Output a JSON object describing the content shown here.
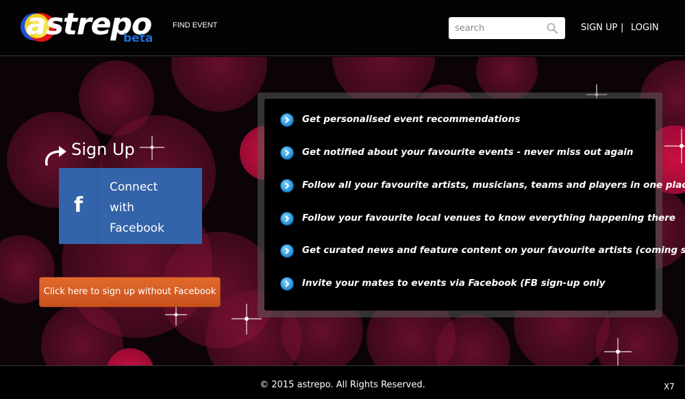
{
  "header": {
    "logo_text": "astrepo",
    "logo_badge": "beta",
    "find_event_label": "FIND EVENT",
    "search": {
      "placeholder": "search",
      "value": ""
    },
    "nav": {
      "signup_label": "SIGN UP",
      "separator": "|",
      "login_label": "LOGIN"
    }
  },
  "signup": {
    "heading": "Sign Up",
    "facebook_button": {
      "icon": "facebook-icon",
      "line1": "Connect",
      "line2": "with",
      "line3": "Facebook"
    },
    "no_facebook_label": "Click here to sign up without Facebook"
  },
  "features": [
    {
      "text": "Get personalised event recommendations"
    },
    {
      "text": "Get notified about your favourite events - never miss out again"
    },
    {
      "text": "Follow all your favourite artists, musicians, teams and players in one place"
    },
    {
      "text": "Follow your favourite local venues to know everything happening there"
    },
    {
      "text": "Get curated news and feature content on your favourite artists (coming soon)"
    },
    {
      "text": "Invite your mates to events via Facebook (FB sign-up only"
    }
  ],
  "footer": {
    "copyright": "© 2015 astrepo. All Rights Reserved.",
    "close_label": "X7"
  },
  "colors": {
    "facebook_blue": "#3363a8",
    "signup_orange": "#d55d24",
    "bullet_blue": "#1e8fd6",
    "beta_blue": "#1f6fd8"
  }
}
